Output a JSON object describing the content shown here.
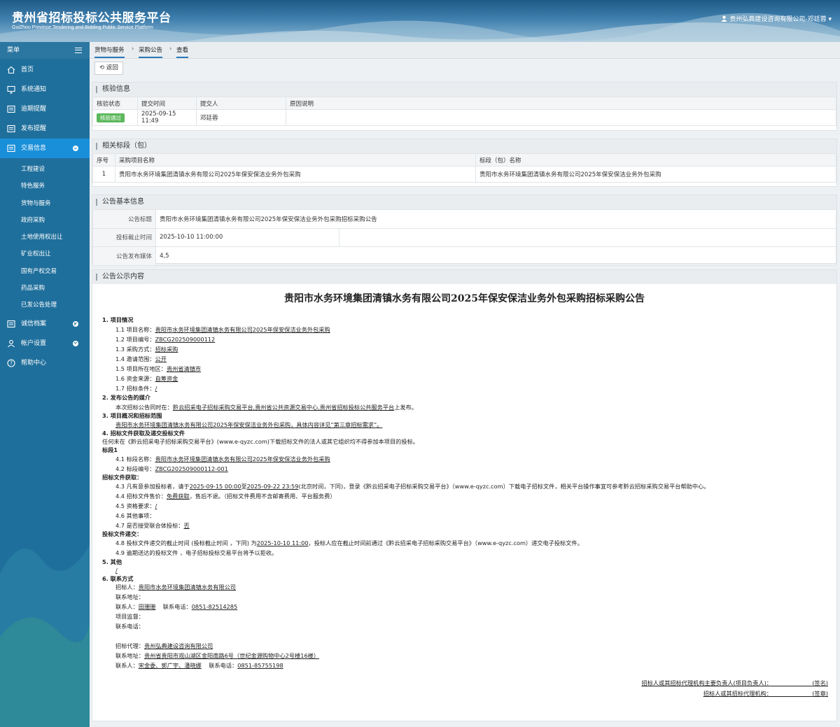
{
  "header": {
    "title": "贵州省招标投标公共服务平台",
    "subtitle": "GuiZhou Province Tendering and Bidding Public Service Platform",
    "user": "贵州弘典建设咨询有限公司-邓廷蓉"
  },
  "sidebar": {
    "menu_label": "菜单",
    "items": [
      {
        "label": "首页",
        "icon": "home-icon"
      },
      {
        "label": "系统通知",
        "icon": "monitor-icon"
      },
      {
        "label": "逾期提醒",
        "icon": "list-icon"
      },
      {
        "label": "发布提醒",
        "icon": "list-icon"
      },
      {
        "label": "交易信息",
        "icon": "list-icon",
        "active": true
      }
    ],
    "sub_items": [
      "工程建设",
      "特色服务",
      "货物与服务",
      "政府采购",
      "土地使用权出让",
      "矿业权出让",
      "国有产权交易",
      "药品采购",
      "已发公告处理"
    ],
    "bottom_items": [
      {
        "label": "诚信档案",
        "icon": "list-icon"
      },
      {
        "label": "帐户设置",
        "icon": "user-icon"
      },
      {
        "label": "帮助中心",
        "icon": "help-icon"
      }
    ]
  },
  "breadcrumb": [
    "货物与服务",
    "采购公告",
    "查看"
  ],
  "back_label": "返回",
  "verify": {
    "title": "核验信息",
    "headers": [
      "核验状态",
      "提交时间",
      "提交人",
      "原因说明"
    ],
    "row": {
      "status": "核验通过",
      "time": "2025-09-15 11:49",
      "person": "邓廷蓉",
      "reason": ""
    }
  },
  "sections": {
    "title": "相关标段（包）",
    "headers": [
      "序号",
      "采购项目名称",
      "标段（包）名称"
    ],
    "row": {
      "no": "1",
      "project": "贵阳市水务环境集团清镇水务有限公司2025年保安保洁业务外包采购",
      "section": "贵阳市水务环境集团清镇水务有限公司2025年保安保洁业务外包采购"
    }
  },
  "basic": {
    "title": "公告基本信息",
    "rows": [
      {
        "k": "公告标题",
        "v": "贵阳市水务环境集团清镇水务有限公司2025年保安保洁业务外包采购招标采购公告"
      },
      {
        "k": "投标截止时间",
        "v": "2025-10-10 11:00:00"
      },
      {
        "k": "公告发布媒体",
        "v": "4,5"
      }
    ]
  },
  "notice": {
    "panel_title": "公告公示内容",
    "title": "贵阳市水务环境集团清镇水务有限公司2025年保安保洁业务外包采购招标采购公告",
    "s1": "1. 项目情况",
    "l11": "1.1 项目名称：",
    "v11": "贵阳市水务环境集团清镇水务有限公司2025年保安保洁业务外包采购",
    "l12": "1.2 项目编号：",
    "v12": "ZBCG202509000112",
    "l13": "1.3 采购方式：",
    "v13": "招标采购",
    "l14": "1.4 邀请范围：",
    "v14": "公开",
    "l15": "1.5 项目所在地区：",
    "v15": "贵州省清镇市",
    "l16": "1.6 资金来源：",
    "v16": "自筹资金",
    "l17": "1.7 招标条件：",
    "v17": "/",
    "s2": "2. 发布公告的媒介",
    "l2a": "本次招标公告同时在：",
    "v2a": "黔云招采电子招标采购交易平台,贵州省公共资源交易中心,贵州省招标投标公共服务平台",
    "l2b": "上发布。",
    "s3": "3. 项目概况和招标范围",
    "v3": "贵阳市水务环境集团清镇水务有限公司2025年保安保洁业务外包采购，具体内容详见“第三章招标需求”。",
    "s4": "4. 招标文件获取及递交投标文件",
    "t4": "任何未在《黔云招采电子招标采购交易平台》(www.e-qyzc.com)下载招标文件的法人或其它组织均不得参加本项目的投标。",
    "bd": "标段1",
    "l41": "4.1 标段名称：",
    "v41": "贵阳市水务环境集团清镇水务有限公司2025年保安保洁业务外包采购",
    "l42": "4.2 标段编号：",
    "v42": "ZBCG202509000112-001",
    "gh": "招标文件获取：",
    "l43a": "4.3 凡有意参加投标者，请于",
    "v43a": "2025-09-15 00:00",
    "l43b": "至",
    "v43b": "2025-09-22 23:59",
    "l43c": "(北京时间，下同)，登录《黔云招采电子招标采购交易平台》（www.e-qyzc.com）下载电子招标文件，相关平台操作事宜可参考黔云招标采购交易平台帮助中心。",
    "l44a": "4.4 招标文件售价：",
    "v44": "免费获取",
    "l44b": "，售后不退。（招标文件费用不含邮寄费用、平台服务费）",
    "l45": "4.5 资格要求：",
    "v45": "/",
    "l46": "4.6 其他事项：",
    "l47": "4.7 是否接受联合体投标：",
    "v47": "否",
    "sh": "投标文件递交：",
    "l48a": "4.8 投标文件递交的截止时间 (投标截止时间 ，下同) 为",
    "v48": "2025-10-10 11:00",
    "l48b": "，投标人应在截止时间前通过《黔云招采电子招标采购交易平台》（www.e-qyzc.com）递交电子投标文件。",
    "l49": "4.9 逾期送达的投标文件 ，电子招标投标交易平台将予以拒收。",
    "s5": "5. 其他",
    "v5": "/",
    "s6": "6. 联系方式",
    "c1l": "招标人：",
    "c1v": "贵阳市水务环境集团清镇水务有限公司",
    "c2l": "联系地址：",
    "c3l": "联系人：",
    "c3v": "田珊珊",
    "c3l2": "联系电话：",
    "c3v2": "0851-82514285",
    "c4l": "项目监督：",
    "c5l": "联系电话：",
    "a1l": "招标代理：",
    "a1v": "贵州弘典建设咨询有限公司",
    "a2l": "联系地址：",
    "a2v": "贵州省贵阳市观山湖区金阳南路6号（世纪金源购物中心2号楼16楼）",
    "a3l": "联系人：",
    "a3v": "宋金委、郭广宇、潘晓娜",
    "a3l2": "联系电话：",
    "a3v2": "0851-85755198",
    "sig1a": "招标人或其招标代理机构主要负责人(项目负责人)：",
    "sig1b": "(签名)",
    "sig2a": "招标人或其招标代理机构：",
    "sig2b": "(签章)"
  }
}
